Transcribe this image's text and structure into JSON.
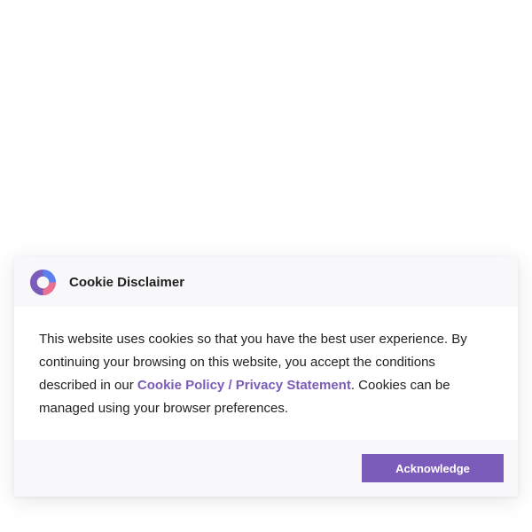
{
  "dialog": {
    "title": "Cookie Disclaimer",
    "logo_icon": "cookie-consent-logo-icon",
    "body": {
      "text_before_link": "This website uses cookies so that you have the best user experience. By continuing your browsing on this website, you accept the conditions described in our ",
      "link_label": "Cookie Policy / Privacy Statement",
      "text_after_link": ". Cookies can be managed using your browser preferences."
    },
    "acknowledge_label": "Acknowledge"
  },
  "colors": {
    "accent": "#7c5cbb",
    "header_footer_bg": "#f8f8fa",
    "logo_blue": "#5b7ff0",
    "logo_purple": "#7c5cbb",
    "logo_pink": "#e8718f"
  }
}
